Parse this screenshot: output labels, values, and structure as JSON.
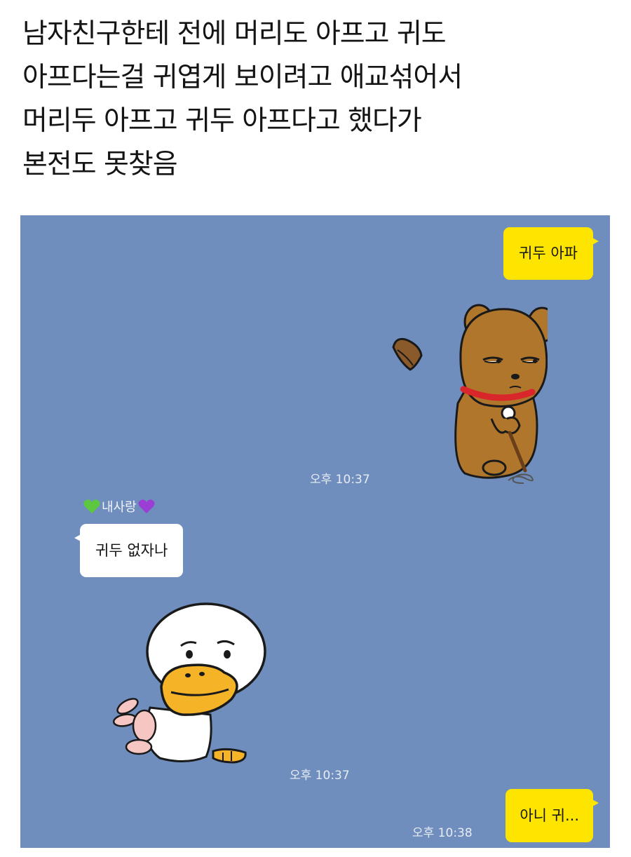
{
  "caption": {
    "lines": [
      "남자친구한테 전에 머리도 아프고 귀도",
      "아프다는걸 귀엽게 보이려고 애교섞어서",
      "머리두 아프고 귀두 아프다고 했다가",
      "본전도 못찾음"
    ]
  },
  "chat": {
    "background_color": "#6f8ebd",
    "my_bubble_color": "#fee500",
    "other_bubble_color": "#ffffff",
    "messages": [
      {
        "sender": "me",
        "type": "text",
        "text": "귀두 아파"
      },
      {
        "sender": "me",
        "type": "sticker",
        "sticker": "brown-dog-sulking-sticker",
        "time": "오후 10:37"
      },
      {
        "sender": "other",
        "type": "text",
        "name": "내사랑",
        "name_left_icon": "green-heart-icon",
        "name_right_icon": "purple-heart-icon",
        "text": "귀두 없자나"
      },
      {
        "sender": "other",
        "type": "sticker",
        "sticker": "duck-worried-sticker",
        "time": "오후 10:37"
      },
      {
        "sender": "me",
        "type": "text",
        "text": "아니 귀...",
        "time": "오후 10:38"
      }
    ]
  }
}
